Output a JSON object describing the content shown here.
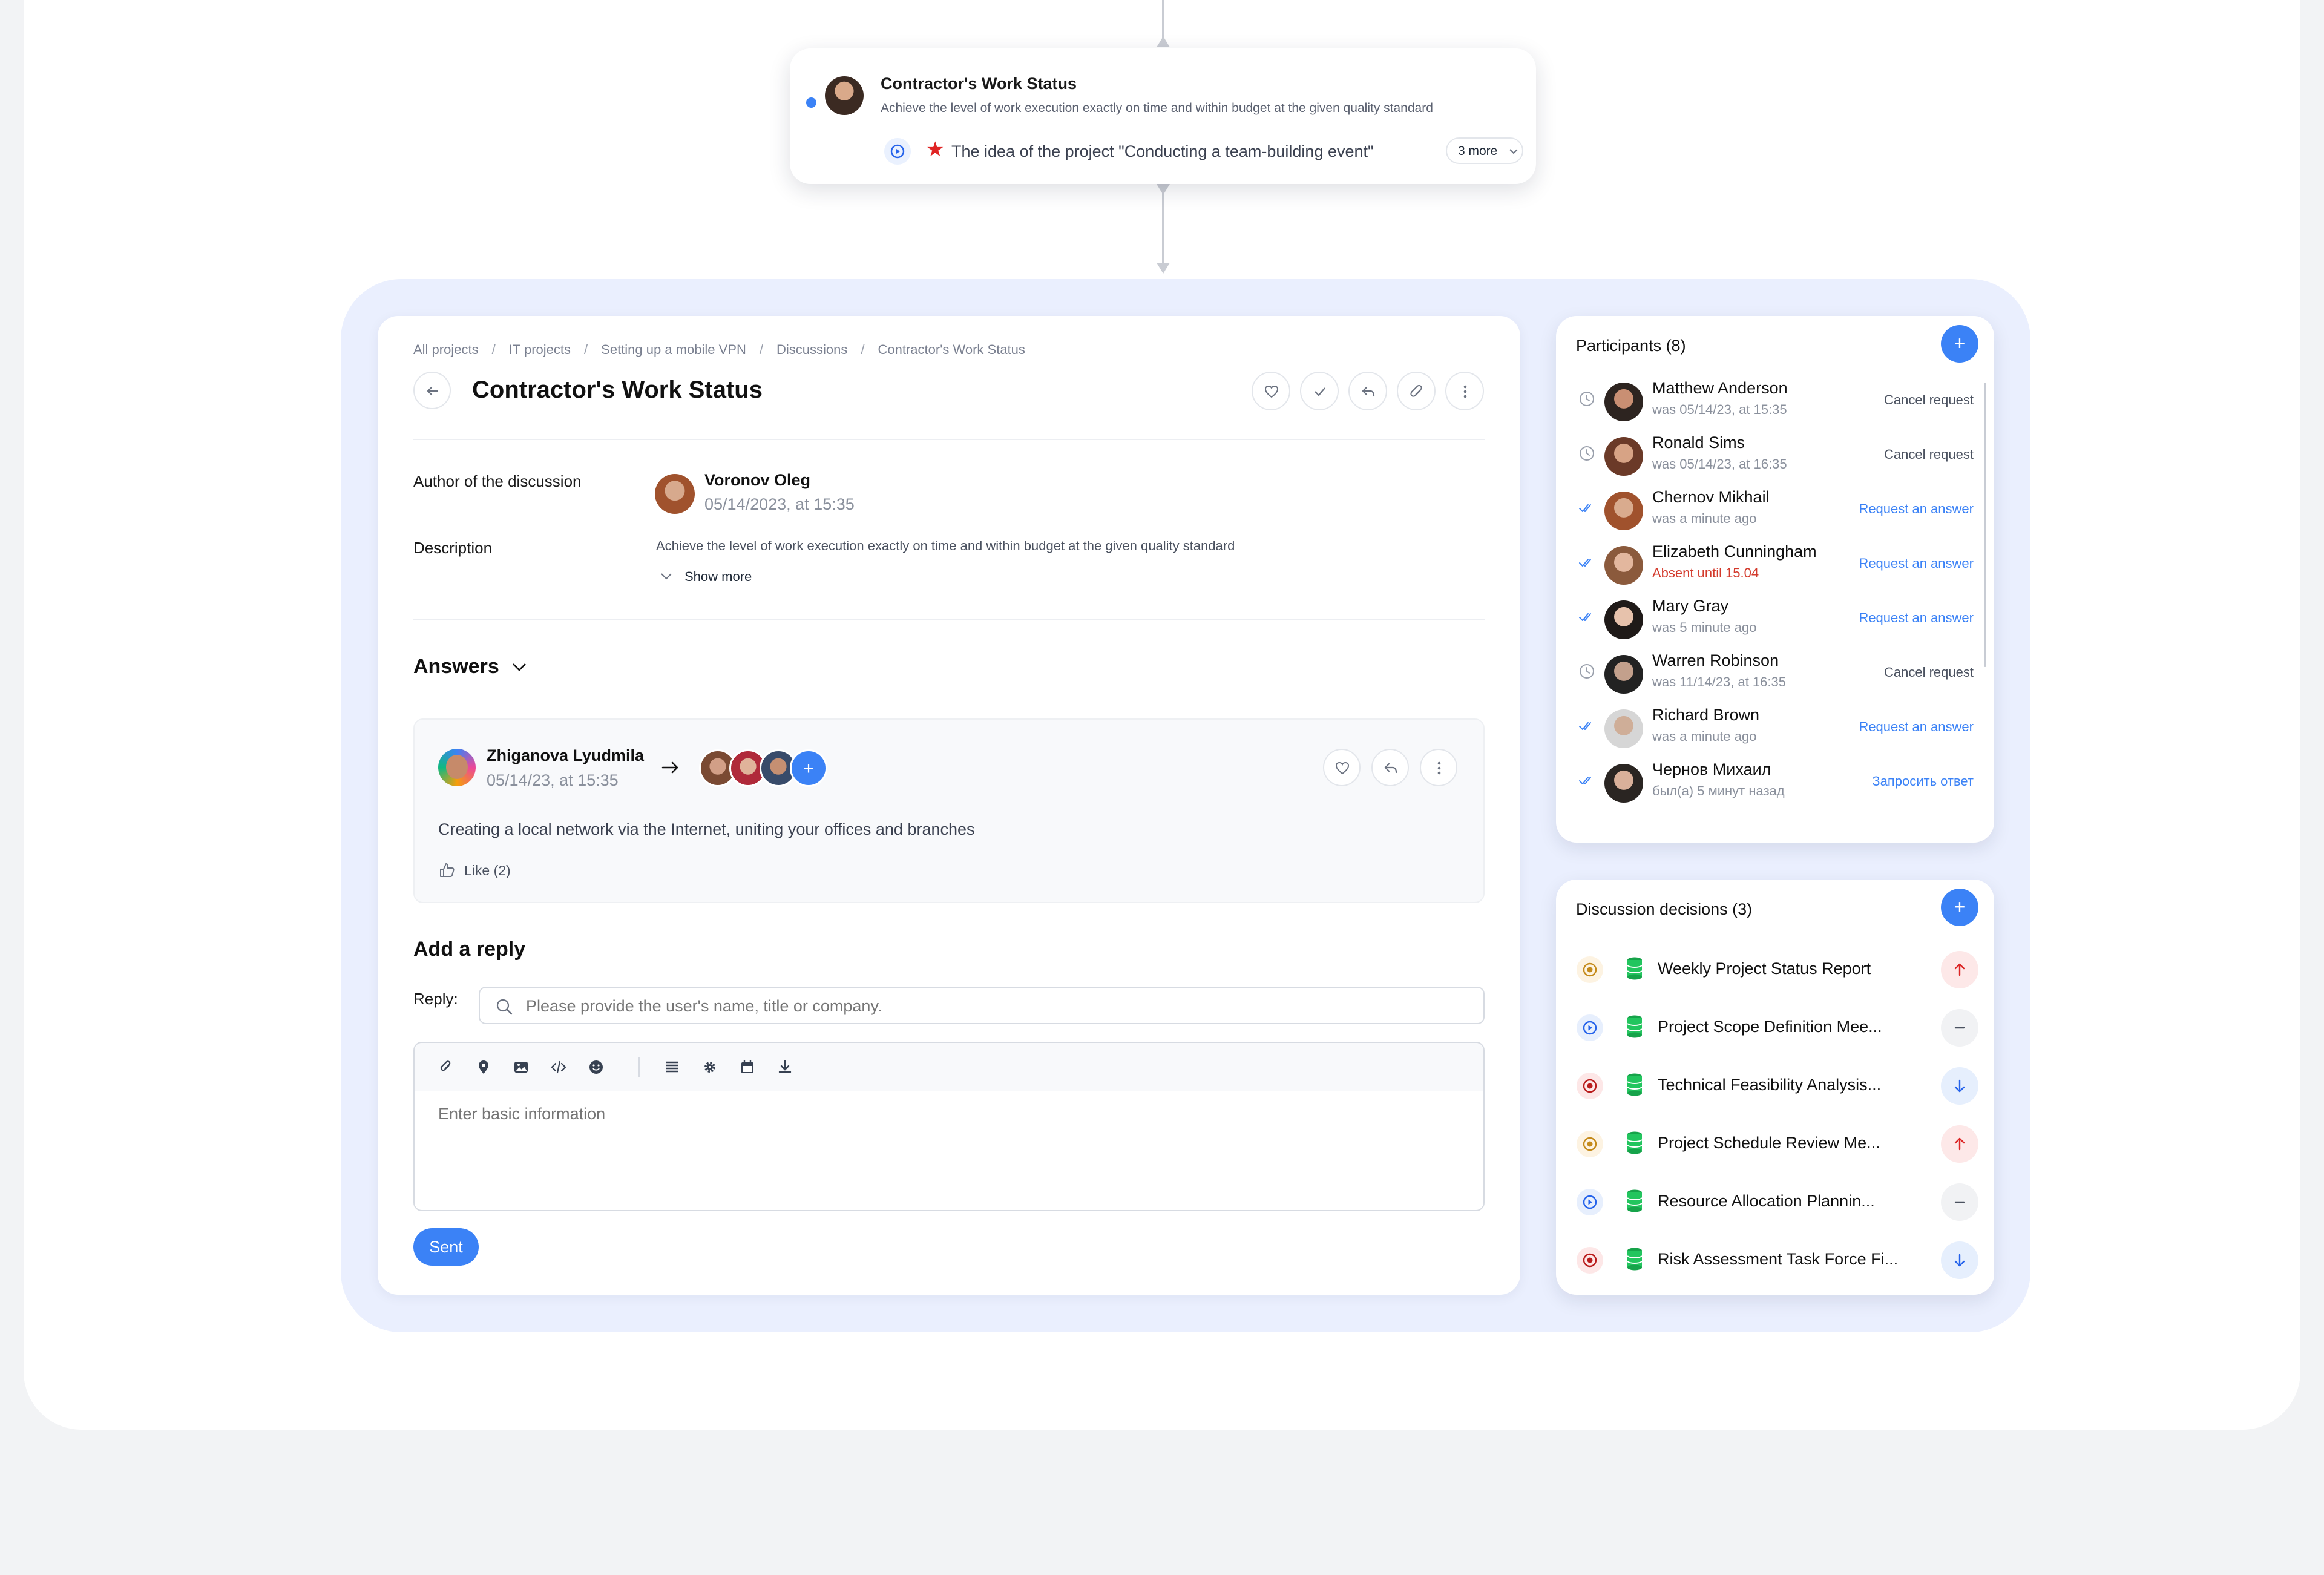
{
  "node": {
    "title": "Contractor's Work Status",
    "description": "Achieve the level of work execution exactly on time and within budget at the given quality standard",
    "idea": "The idea of the project \"Conducting a team-building event\"",
    "more": "3 more"
  },
  "breadcrumb": [
    "All projects",
    "IT projects",
    "Setting up a mobile VPN",
    "Discussions",
    "Contractor's Work Status"
  ],
  "page_title": "Contractor's Work Status",
  "author": {
    "label": "Author of the discussion",
    "name": "Voronov Oleg",
    "date": "05/14/2023, at 15:35"
  },
  "description": {
    "label": "Description",
    "text": "Achieve the level of work execution exactly on time and within budget at the given quality standard",
    "show_more": "Show more"
  },
  "answers": {
    "heading": "Answers",
    "item": {
      "name": "Zhiganova Lyudmila",
      "date": "05/14/23, at 15:35",
      "text": "Creating a local network via the Internet, uniting your offices and branches",
      "like": "Like (2)"
    }
  },
  "reply": {
    "heading": "Add a reply",
    "label": "Reply:",
    "search_placeholder": "Please provide the user's name, title or company.",
    "editor_placeholder": "Enter basic information",
    "send": "Sent"
  },
  "participants": {
    "title": "Participants (8)",
    "items": [
      {
        "name": "Matthew Anderson",
        "sub": "was 05/14/23, at 15:35",
        "action": "Cancel request",
        "status": "clock",
        "absent": false
      },
      {
        "name": "Ronald Sims",
        "sub": "was 05/14/23, at 16:35",
        "action": "Cancel request",
        "status": "clock",
        "absent": false
      },
      {
        "name": "Chernov Mikhail",
        "sub": "was a minute ago",
        "action": "Request an answer",
        "status": "check",
        "absent": false
      },
      {
        "name": "Elizabeth Cunningham",
        "sub": "Absent until 15.04",
        "action": "Request an answer",
        "status": "check",
        "absent": true
      },
      {
        "name": "Mary Gray",
        "sub": "was 5 minute ago",
        "action": "Request an answer",
        "status": "check",
        "absent": false
      },
      {
        "name": "Warren Robinson",
        "sub": "was 11/14/23, at 16:35",
        "action": "Cancel request",
        "status": "clock",
        "absent": false
      },
      {
        "name": "Richard Brown",
        "sub": "was a minute ago",
        "action": "Request an answer",
        "status": "check",
        "absent": false
      },
      {
        "name": "Чернов Михаил",
        "sub": "был(а) 5 минут назад",
        "action": "Запросить ответ",
        "status": "check",
        "absent": false
      }
    ]
  },
  "decisions": {
    "title": "Discussion decisions (3)",
    "items": [
      {
        "name": "Weekly Project Status Report",
        "kind": "target-orange",
        "trend": "up"
      },
      {
        "name": "Project Scope Definition Mee...",
        "kind": "play-blue",
        "trend": "flat"
      },
      {
        "name": "Technical Feasibility Analysis...",
        "kind": "target-red",
        "trend": "down"
      },
      {
        "name": "Project Schedule Review Me...",
        "kind": "target-orange",
        "trend": "up"
      },
      {
        "name": "Resource Allocation Plannin...",
        "kind": "play-blue",
        "trend": "flat"
      },
      {
        "name": "Risk Assessment Task Force Fi...",
        "kind": "target-red",
        "trend": "down"
      }
    ]
  },
  "colors": {
    "accent": "#3b82f6",
    "frame_bg": "#eaeffe",
    "star": "#e02424",
    "absent": "#d33a2c",
    "db_green": "#16a34a"
  }
}
